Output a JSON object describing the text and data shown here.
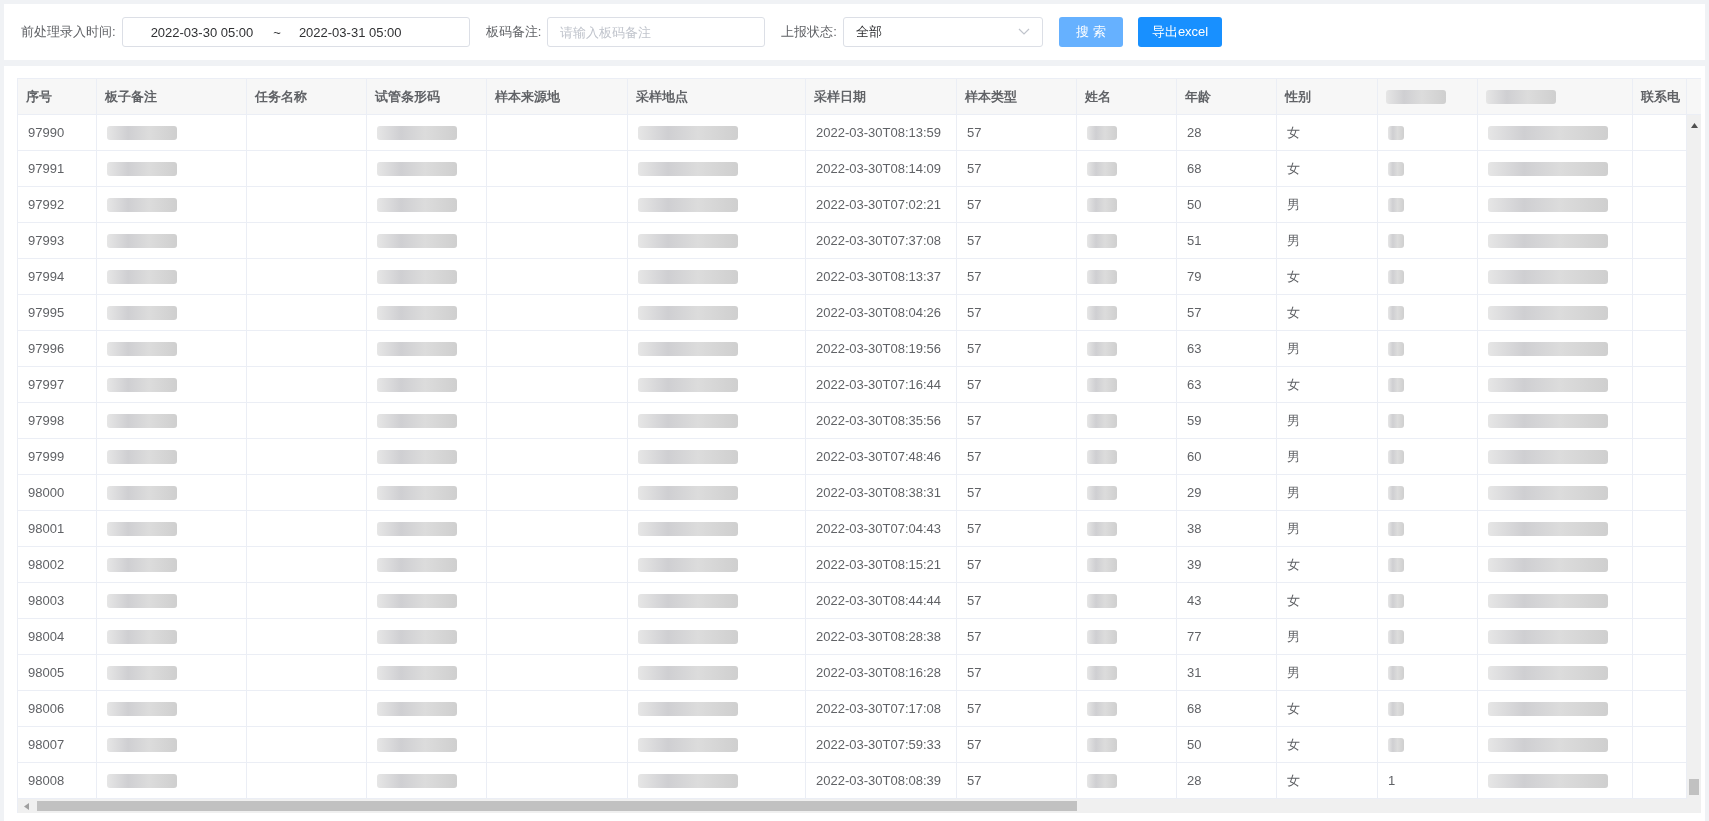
{
  "filters": {
    "time_label": "前处理录入时间:",
    "time_start": "2022-03-30 05:00",
    "time_separator": "~",
    "time_end": "2022-03-31 05:00",
    "note_label": "板码备注:",
    "note_placeholder": "请输入板码备注",
    "status_label": "上报状态:",
    "status_value": "全部",
    "search_button": "搜 索",
    "export_button": "导出excel"
  },
  "table": {
    "columns": [
      {
        "label": "序号",
        "kind": "text"
      },
      {
        "label": "板子备注",
        "kind": "blurred"
      },
      {
        "label": "任务名称",
        "kind": "empty"
      },
      {
        "label": "试管条形码",
        "kind": "blurred"
      },
      {
        "label": "样本来源地",
        "kind": "empty"
      },
      {
        "label": "采样地点",
        "kind": "blurred"
      },
      {
        "label": "采样日期",
        "kind": "text"
      },
      {
        "label": "样本类型",
        "kind": "text"
      },
      {
        "label": "姓名",
        "kind": "blurred"
      },
      {
        "label": "年龄",
        "kind": "text"
      },
      {
        "label": "性别",
        "kind": "text"
      },
      {
        "kind": "blurred"
      },
      {
        "kind": "blurred"
      },
      {
        "label": "联系电",
        "kind": "empty"
      }
    ],
    "rows": [
      {
        "values": [
          "97990",
          "2022-03-30T08:13:59",
          "57",
          "28",
          "女"
        ]
      },
      {
        "values": [
          "97991",
          "2022-03-30T08:14:09",
          "57",
          "68",
          "女"
        ]
      },
      {
        "values": [
          "97992",
          "2022-03-30T07:02:21",
          "57",
          "50",
          "男"
        ]
      },
      {
        "values": [
          "97993",
          "2022-03-30T07:37:08",
          "57",
          "51",
          "男"
        ]
      },
      {
        "values": [
          "97994",
          "2022-03-30T08:13:37",
          "57",
          "79",
          "女"
        ]
      },
      {
        "values": [
          "97995",
          "2022-03-30T08:04:26",
          "57",
          "57",
          "女"
        ]
      },
      {
        "values": [
          "97996",
          "2022-03-30T08:19:56",
          "57",
          "63",
          "男"
        ]
      },
      {
        "values": [
          "97997",
          "2022-03-30T07:16:44",
          "57",
          "63",
          "女"
        ]
      },
      {
        "values": [
          "97998",
          "2022-03-30T08:35:56",
          "57",
          "59",
          "男"
        ]
      },
      {
        "values": [
          "97999",
          "2022-03-30T07:48:46",
          "57",
          "60",
          "男"
        ]
      },
      {
        "values": [
          "98000",
          "2022-03-30T08:38:31",
          "57",
          "29",
          "男"
        ]
      },
      {
        "values": [
          "98001",
          "2022-03-30T07:04:43",
          "57",
          "38",
          "男"
        ]
      },
      {
        "values": [
          "98002",
          "2022-03-30T08:15:21",
          "57",
          "39",
          "女"
        ]
      },
      {
        "values": [
          "98003",
          "2022-03-30T08:44:44",
          "57",
          "43",
          "女"
        ]
      },
      {
        "values": [
          "98004",
          "2022-03-30T08:28:38",
          "57",
          "77",
          "男"
        ]
      },
      {
        "values": [
          "98005",
          "2022-03-30T08:16:28",
          "57",
          "31",
          "男"
        ]
      },
      {
        "values": [
          "98006",
          "2022-03-30T07:17:08",
          "57",
          "68",
          "女"
        ]
      },
      {
        "values": [
          "98007",
          "2022-03-30T07:59:33",
          "57",
          "50",
          "女"
        ]
      },
      {
        "values": [
          "98008",
          "2022-03-30T08:08:39",
          "57",
          "28",
          "女"
        ],
        "column_12": "1"
      }
    ]
  }
}
